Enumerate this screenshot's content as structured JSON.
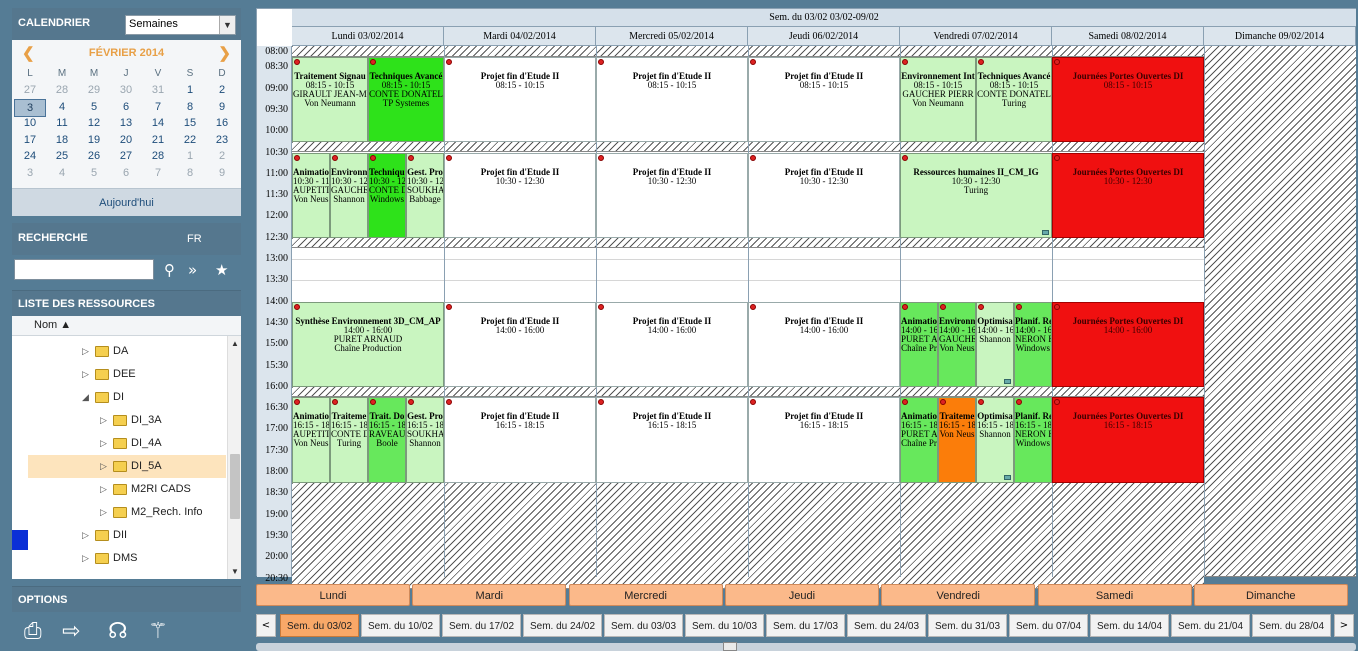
{
  "sidebar": {
    "calendar_title": "CALENDRIER",
    "view_select": "Semaines",
    "month": "FÉVRIER 2014",
    "prev": "❮",
    "next": "❯",
    "dow": [
      "L",
      "M",
      "M",
      "J",
      "V",
      "S",
      "D"
    ],
    "weeks": [
      [
        [
          "27",
          1
        ],
        [
          "28",
          1
        ],
        [
          "29",
          1
        ],
        [
          "30",
          1
        ],
        [
          "31",
          1
        ],
        [
          "1",
          0
        ],
        [
          "2",
          0
        ]
      ],
      [
        [
          "3",
          2
        ],
        [
          "4",
          0
        ],
        [
          "5",
          0
        ],
        [
          "6",
          0
        ],
        [
          "7",
          0
        ],
        [
          "8",
          0
        ],
        [
          "9",
          0
        ]
      ],
      [
        [
          "10",
          0
        ],
        [
          "11",
          0
        ],
        [
          "12",
          0
        ],
        [
          "13",
          0
        ],
        [
          "14",
          0
        ],
        [
          "15",
          0
        ],
        [
          "16",
          0
        ]
      ],
      [
        [
          "17",
          0
        ],
        [
          "18",
          0
        ],
        [
          "19",
          0
        ],
        [
          "20",
          0
        ],
        [
          "21",
          0
        ],
        [
          "22",
          0
        ],
        [
          "23",
          0
        ]
      ],
      [
        [
          "24",
          0
        ],
        [
          "25",
          0
        ],
        [
          "26",
          0
        ],
        [
          "27",
          0
        ],
        [
          "28",
          0
        ],
        [
          "1",
          1
        ],
        [
          "2",
          1
        ]
      ],
      [
        [
          "3",
          1
        ],
        [
          "4",
          1
        ],
        [
          "5",
          1
        ],
        [
          "6",
          1
        ],
        [
          "7",
          1
        ],
        [
          "8",
          1
        ],
        [
          "9",
          1
        ]
      ]
    ],
    "today": "Aujourd'hui",
    "search_title": "RECHERCHE",
    "lang": "FR",
    "resources_title": "LISTE DES RESSOURCES",
    "col_name": "Nom ▲",
    "tree": [
      {
        "label": "DA",
        "level": 0,
        "tog": "▷"
      },
      {
        "label": "DEE",
        "level": 0,
        "tog": "▷"
      },
      {
        "label": "DI",
        "level": 0,
        "tog": "◢"
      },
      {
        "label": "DI_3A",
        "level": 1,
        "tog": "▷"
      },
      {
        "label": "DI_4A",
        "level": 1,
        "tog": "▷"
      },
      {
        "label": "DI_5A",
        "level": 1,
        "tog": "▷",
        "sel": true
      },
      {
        "label": "M2RI CADS",
        "level": 1,
        "tog": "▷"
      },
      {
        "label": "M2_Rech. Info",
        "level": 1,
        "tog": "▷"
      },
      {
        "label": "DII",
        "level": 0,
        "tog": "▷"
      },
      {
        "label": "DMS",
        "level": 0,
        "tog": "▷"
      }
    ],
    "options_title": "OPTIONS"
  },
  "schedule": {
    "week_title": "Sem. du 03/02 03/02-09/02",
    "days": [
      "Lundi 03/02/2014",
      "Mardi 04/02/2014",
      "Mercredi 05/02/2014",
      "Jeudi 06/02/2014",
      "Vendredi 07/02/2014",
      "Samedi 08/02/2014",
      "Dimanche 09/02/2014"
    ],
    "times": [
      "08:00",
      "08:30",
      "09:00",
      "09:30",
      "10:00",
      "10:30",
      "11:00",
      "11:30",
      "12:00",
      "12:30",
      "13:00",
      "13:30",
      "14:00",
      "14:30",
      "15:00",
      "15:30",
      "16:00",
      "16:30",
      "17:00",
      "17:30",
      "18:00",
      "18:30",
      "19:00",
      "19:30",
      "20:00",
      "20:30"
    ],
    "colors": {
      "light": "#c9f5c0",
      "green": "#2ee21a",
      "mid": "#67e85c",
      "white": "#ffffff",
      "red": "#f01010",
      "orange": "#fb7d0a"
    },
    "events": [
      {
        "day": 0,
        "sub": 0,
        "subs": 2,
        "start": "08:15",
        "end": "10:15",
        "color": "light",
        "title": "Traitement Signau",
        "lines": [
          "08:15 - 10:15",
          "GIRAULT JEAN-MARC",
          "Von Neumann"
        ]
      },
      {
        "day": 0,
        "sub": 1,
        "subs": 2,
        "start": "08:15",
        "end": "10:15",
        "color": "green",
        "title": "Techniques Avancé",
        "lines": [
          "08:15 - 10:15",
          "CONTE DONATEL",
          "TP Systemes"
        ]
      },
      {
        "day": 1,
        "sub": 0,
        "subs": 1,
        "start": "08:15",
        "end": "10:15",
        "color": "white",
        "title": "Projet fin d'Etude II",
        "lines": [
          "08:15 - 10:15"
        ]
      },
      {
        "day": 2,
        "sub": 0,
        "subs": 1,
        "start": "08:15",
        "end": "10:15",
        "color": "white",
        "title": "Projet fin d'Etude II",
        "lines": [
          "08:15 - 10:15"
        ]
      },
      {
        "day": 3,
        "sub": 0,
        "subs": 1,
        "start": "08:15",
        "end": "10:15",
        "color": "white",
        "title": "Projet fin d'Etude II",
        "lines": [
          "08:15 - 10:15"
        ]
      },
      {
        "day": 4,
        "sub": 0,
        "subs": 2,
        "start": "08:15",
        "end": "10:15",
        "color": "light",
        "title": "Environnement Int",
        "lines": [
          "08:15 - 10:15",
          "GAUCHER PIERR",
          "Von Neumann"
        ]
      },
      {
        "day": 4,
        "sub": 1,
        "subs": 2,
        "start": "08:15",
        "end": "10:15",
        "color": "light",
        "title": "Techniques Avancé",
        "lines": [
          "08:15 - 10:15",
          "CONTE DONATEL",
          "Turing"
        ]
      },
      {
        "day": 5,
        "sub": 0,
        "subs": 1,
        "start": "08:15",
        "end": "10:15",
        "color": "red",
        "title": "Journées Portes Ouvertes DI",
        "lines": [
          "08:15 - 10:15"
        ]
      },
      {
        "day": 0,
        "sub": 0,
        "subs": 4,
        "start": "10:30",
        "end": "12:30",
        "color": "light",
        "title": "Animatio",
        "lines": [
          "10:30 - 11",
          "AUPETIT",
          "Von Neus"
        ]
      },
      {
        "day": 0,
        "sub": 1,
        "subs": 4,
        "start": "10:30",
        "end": "12:30",
        "color": "light",
        "title": "Environn",
        "lines": [
          "10:30 - 12",
          "GAUCHE",
          "Shannon"
        ]
      },
      {
        "day": 0,
        "sub": 2,
        "subs": 4,
        "start": "10:30",
        "end": "12:30",
        "color": "green",
        "title": "Technique",
        "lines": [
          "10:30 - 12",
          "CONTE D",
          "Windows"
        ]
      },
      {
        "day": 0,
        "sub": 3,
        "subs": 4,
        "start": "10:30",
        "end": "12:30",
        "color": "light",
        "title": "Gest. Pro",
        "lines": [
          "10:30 - 12",
          "SOUKHA",
          "Babbage"
        ]
      },
      {
        "day": 1,
        "sub": 0,
        "subs": 1,
        "start": "10:30",
        "end": "12:30",
        "color": "white",
        "title": "Projet fin d'Etude II",
        "lines": [
          "10:30 - 12:30"
        ]
      },
      {
        "day": 2,
        "sub": 0,
        "subs": 1,
        "start": "10:30",
        "end": "12:30",
        "color": "white",
        "title": "Projet fin d'Etude II",
        "lines": [
          "10:30 - 12:30"
        ]
      },
      {
        "day": 3,
        "sub": 0,
        "subs": 1,
        "start": "10:30",
        "end": "12:30",
        "color": "white",
        "title": "Projet fin d'Etude II",
        "lines": [
          "10:30 - 12:30"
        ]
      },
      {
        "day": 4,
        "sub": 0,
        "subs": 1,
        "start": "10:30",
        "end": "12:30",
        "color": "light",
        "title": "Ressources humaines II_CM_IG",
        "lines": [
          "10:30 - 12:30",
          "Turing"
        ],
        "pin": true
      },
      {
        "day": 5,
        "sub": 0,
        "subs": 1,
        "start": "10:30",
        "end": "12:30",
        "color": "red",
        "title": "Journées Portes Ouvertes DI",
        "lines": [
          "10:30 - 12:30"
        ]
      },
      {
        "day": 0,
        "sub": 0,
        "subs": 1,
        "start": "14:00",
        "end": "16:00",
        "color": "light",
        "title": "Synthèse Environnement 3D_CM_AP",
        "lines": [
          "14:00 - 16:00",
          "PURET ARNAUD",
          "Chaîne Production"
        ]
      },
      {
        "day": 1,
        "sub": 0,
        "subs": 1,
        "start": "14:00",
        "end": "16:00",
        "color": "white",
        "title": "Projet fin d'Etude II",
        "lines": [
          "14:00 - 16:00"
        ]
      },
      {
        "day": 2,
        "sub": 0,
        "subs": 1,
        "start": "14:00",
        "end": "16:00",
        "color": "white",
        "title": "Projet fin d'Etude II",
        "lines": [
          "14:00 - 16:00"
        ]
      },
      {
        "day": 3,
        "sub": 0,
        "subs": 1,
        "start": "14:00",
        "end": "16:00",
        "color": "white",
        "title": "Projet fin d'Etude II",
        "lines": [
          "14:00 - 16:00"
        ]
      },
      {
        "day": 4,
        "sub": 0,
        "subs": 4,
        "start": "14:00",
        "end": "16:00",
        "color": "mid",
        "title": "Animatio",
        "lines": [
          "14:00 - 16",
          "PURET A",
          "Chaîne Pr"
        ]
      },
      {
        "day": 4,
        "sub": 1,
        "subs": 4,
        "start": "14:00",
        "end": "16:00",
        "color": "mid",
        "title": "Environn",
        "lines": [
          "14:00 - 16",
          "GAUCHE",
          "Von Neus"
        ]
      },
      {
        "day": 4,
        "sub": 2,
        "subs": 4,
        "start": "14:00",
        "end": "16:00",
        "color": "light",
        "title": "Optimisa",
        "lines": [
          "14:00 - 16",
          "Shannon"
        ],
        "pin": true
      },
      {
        "day": 4,
        "sub": 3,
        "subs": 4,
        "start": "14:00",
        "end": "16:00",
        "color": "mid",
        "title": "Planif. Re",
        "lines": [
          "14:00 - 16",
          "NERON E",
          "Windows"
        ]
      },
      {
        "day": 5,
        "sub": 0,
        "subs": 1,
        "start": "14:00",
        "end": "16:00",
        "color": "red",
        "title": "Journées Portes Ouvertes DI",
        "lines": [
          "14:00 - 16:00"
        ]
      },
      {
        "day": 0,
        "sub": 0,
        "subs": 4,
        "start": "16:15",
        "end": "18:15",
        "color": "light",
        "title": "Animatio",
        "lines": [
          "16:15 - 18",
          "AUPETIT",
          "Von Neus"
        ]
      },
      {
        "day": 0,
        "sub": 1,
        "subs": 4,
        "start": "16:15",
        "end": "18:15",
        "color": "light",
        "title": "Traiteme",
        "lines": [
          "16:15 - 18",
          "CONTE D",
          "Turing"
        ]
      },
      {
        "day": 0,
        "sub": 2,
        "subs": 4,
        "start": "16:15",
        "end": "18:15",
        "color": "mid",
        "title": "Trait. Do",
        "lines": [
          "16:15 - 18",
          "RAVEAU",
          "Boole"
        ]
      },
      {
        "day": 0,
        "sub": 3,
        "subs": 4,
        "start": "16:15",
        "end": "18:15",
        "color": "light",
        "title": "Gest. Pro",
        "lines": [
          "16:15 - 18",
          "SOUKHA",
          "Shannon"
        ]
      },
      {
        "day": 1,
        "sub": 0,
        "subs": 1,
        "start": "16:15",
        "end": "18:15",
        "color": "white",
        "title": "Projet fin d'Etude II",
        "lines": [
          "16:15 - 18:15"
        ]
      },
      {
        "day": 2,
        "sub": 0,
        "subs": 1,
        "start": "16:15",
        "end": "18:15",
        "color": "white",
        "title": "Projet fin d'Etude II",
        "lines": [
          "16:15 - 18:15"
        ]
      },
      {
        "day": 3,
        "sub": 0,
        "subs": 1,
        "start": "16:15",
        "end": "18:15",
        "color": "white",
        "title": "Projet fin d'Etude II",
        "lines": [
          "16:15 - 18:15"
        ]
      },
      {
        "day": 4,
        "sub": 0,
        "subs": 4,
        "start": "16:15",
        "end": "18:15",
        "color": "mid",
        "title": "Animatio",
        "lines": [
          "16:15 - 18",
          "PURET A",
          "Chaîne Pr"
        ]
      },
      {
        "day": 4,
        "sub": 1,
        "subs": 4,
        "start": "16:15",
        "end": "18:15",
        "color": "orange",
        "title": "Traiteme",
        "lines": [
          "16:15 - 18",
          "Von Neus"
        ]
      },
      {
        "day": 4,
        "sub": 2,
        "subs": 4,
        "start": "16:15",
        "end": "18:15",
        "color": "light",
        "title": "Optimisa",
        "lines": [
          "16:15 - 18",
          "Shannon"
        ],
        "pin": true
      },
      {
        "day": 4,
        "sub": 3,
        "subs": 4,
        "start": "16:15",
        "end": "18:15",
        "color": "mid",
        "title": "Planif. Re",
        "lines": [
          "16:15 - 18",
          "NERON E",
          "Windows"
        ]
      },
      {
        "day": 5,
        "sub": 0,
        "subs": 1,
        "start": "16:15",
        "end": "18:15",
        "color": "red",
        "title": "Journées Portes Ouvertes DI",
        "lines": [
          "16:15 - 18:15"
        ]
      }
    ]
  },
  "day_buttons": [
    "Lundi",
    "Mardi",
    "Mercredi",
    "Jeudi",
    "Vendredi",
    "Samedi",
    "Dimanche"
  ],
  "week_buttons": [
    "Sem. du 03/02",
    "Sem. du 10/02",
    "Sem. du 17/02",
    "Sem. du 24/02",
    "Sem. du 03/03",
    "Sem. du 10/03",
    "Sem. du 17/03",
    "Sem. du 24/03",
    "Sem. du 31/03",
    "Sem. du 07/04",
    "Sem. du 14/04",
    "Sem. du 21/04",
    "Sem. du 28/04"
  ],
  "week_nav": {
    "prev": "<",
    "next": ">"
  }
}
